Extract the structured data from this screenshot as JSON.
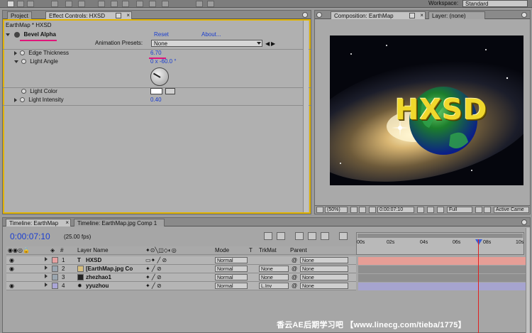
{
  "workspace": {
    "label": "Workspace:",
    "value": "Standard"
  },
  "effect_panel": {
    "tabs": [
      {
        "label": "Project"
      },
      {
        "label": "Effect Controls: HXSD"
      }
    ],
    "breadcrumb": "EarthMap * HXSD",
    "effect_name": "Bevel Alpha",
    "reset_label": "Reset",
    "about_label": "About...",
    "presets_label": "Animation Presets:",
    "presets_value": "None",
    "props": {
      "edge_thickness": {
        "label": "Edge Thickness",
        "value": "6.70"
      },
      "light_angle": {
        "label": "Light Angle",
        "value": "0 x -60.0 °"
      },
      "light_color": {
        "label": "Light Color"
      },
      "light_intensity": {
        "label": "Light Intensity",
        "value": "0.40"
      }
    }
  },
  "composition_panel": {
    "tabs": [
      {
        "label": "Composition: EarthMap"
      },
      {
        "label": "Layer: (none)"
      }
    ],
    "viewer_text": "HXSD",
    "zoom": "(50%)",
    "timecode": "0:00:07:10",
    "resolution": "Full",
    "camera": "Active Came"
  },
  "timeline": {
    "tabs": [
      {
        "label": "Timeline: EarthMap"
      },
      {
        "label": "Timeline: EarthMap.jpg Comp 1"
      }
    ],
    "current_time": "0:00:07:10",
    "fps": "(25.00 fps)",
    "headers": {
      "num": "#",
      "layer_name": "Layer Name",
      "mode": "Mode",
      "t": "T",
      "trkmat": "TrkMat",
      "parent": "Parent"
    },
    "ruler": [
      "00s",
      "02s",
      "04s",
      "06s",
      "08s",
      "10s"
    ],
    "layers": [
      {
        "num": "1",
        "name": "HXSD",
        "mode": "Normal",
        "trkmat": "",
        "parent": "None"
      },
      {
        "num": "2",
        "name": "[EarthMap.jpg Co",
        "mode": "Normal",
        "trkmat": "None",
        "parent": "None"
      },
      {
        "num": "3",
        "name": "zhezhao1",
        "mode": "Normal",
        "trkmat": "None",
        "parent": "None"
      },
      {
        "num": "4",
        "name": "yyuzhou",
        "mode": "Normal",
        "trkmat": "L.Inv",
        "parent": "None"
      }
    ]
  },
  "watermark": "香云AE后期学习吧 【www.linecg.com/tieba/1775】",
  "colors": {
    "accent_yellow": "#e1b300",
    "underline_pink": "#e0157a",
    "value_blue": "#1a3ed0",
    "playhead_red": "#e02020"
  }
}
